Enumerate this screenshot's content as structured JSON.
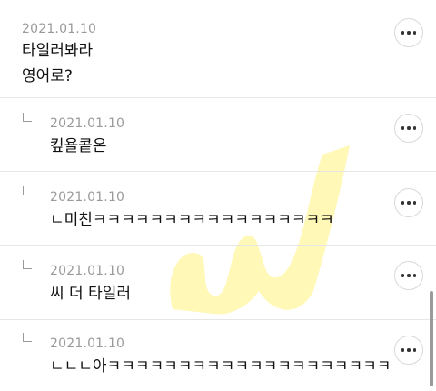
{
  "comments": [
    {
      "date": "2021.01.10",
      "text": "타일러봐라\n영어로?",
      "is_reply": false,
      "more_label": "more options"
    },
    {
      "date": "2021.01.10",
      "text": "킾욜콭온",
      "is_reply": true,
      "more_label": "more options"
    },
    {
      "date": "2021.01.10",
      "text": "ㄴ미친ㅋㅋㅋㅋㅋㅋㅋㅋㅋㅋㅋㅋㅋㅋㅋㅋㅋ",
      "is_reply": true,
      "more_label": "more options"
    },
    {
      "date": "2021.01.10",
      "text": "씨 더 타일러",
      "is_reply": true,
      "more_label": "more options"
    },
    {
      "date": "2021.01.10",
      "text": "ㄴㄴㄴ아ㅋㅋㅋㅋㅋㅋㅋㅋㅋㅋㅋㅋㅋㅋㅋㅋㅋㅋㅋㅋ",
      "is_reply": true,
      "more_label": "more options"
    }
  ],
  "icons": {
    "more": "more-horizontal-icon",
    "reply": "reply-arrow-icon"
  },
  "colors": {
    "date": "#9a9a9a",
    "divider": "#e6e6e6",
    "watermark": "#fff59d"
  }
}
